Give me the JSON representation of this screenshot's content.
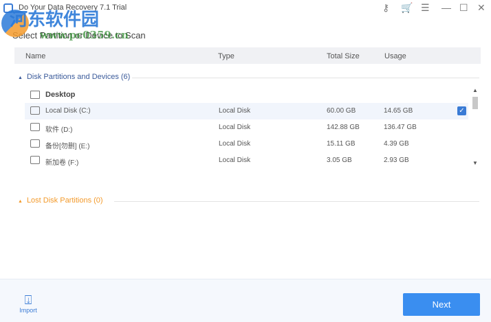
{
  "window": {
    "title": "Do Your Data Recovery 7.1 Trial"
  },
  "watermark": {
    "text": "河东软件园",
    "url": "www.pc0359.cn"
  },
  "heading": "Select Partition or Device to Scan",
  "columns": {
    "name": "Name",
    "type": "Type",
    "total": "Total Size",
    "usage": "Usage"
  },
  "groups": {
    "disks": "Disk Partitions and Devices (6)",
    "lost": "Lost Disk Partitions (0)"
  },
  "desktop": "Desktop",
  "rows": [
    {
      "name": "Local Disk (C:)",
      "type": "Local Disk",
      "total": "60.00 GB",
      "usage": "14.65 GB",
      "checked": true
    },
    {
      "name": "软件 (D:)",
      "type": "Local Disk",
      "total": "142.88 GB",
      "usage": "136.47 GB",
      "checked": false
    },
    {
      "name": "备份[勿删] (E:)",
      "type": "Local Disk",
      "total": "15.11 GB",
      "usage": "4.39 GB",
      "checked": false
    },
    {
      "name": "新加卷 (F:)",
      "type": "Local Disk",
      "total": "3.05 GB",
      "usage": "2.93 GB",
      "checked": false
    }
  ],
  "footer": {
    "import": "Import",
    "next": "Next"
  },
  "colors": {
    "accent": "#3a8ef0",
    "lost": "#f39a2b",
    "group": "#3a5a9a"
  }
}
